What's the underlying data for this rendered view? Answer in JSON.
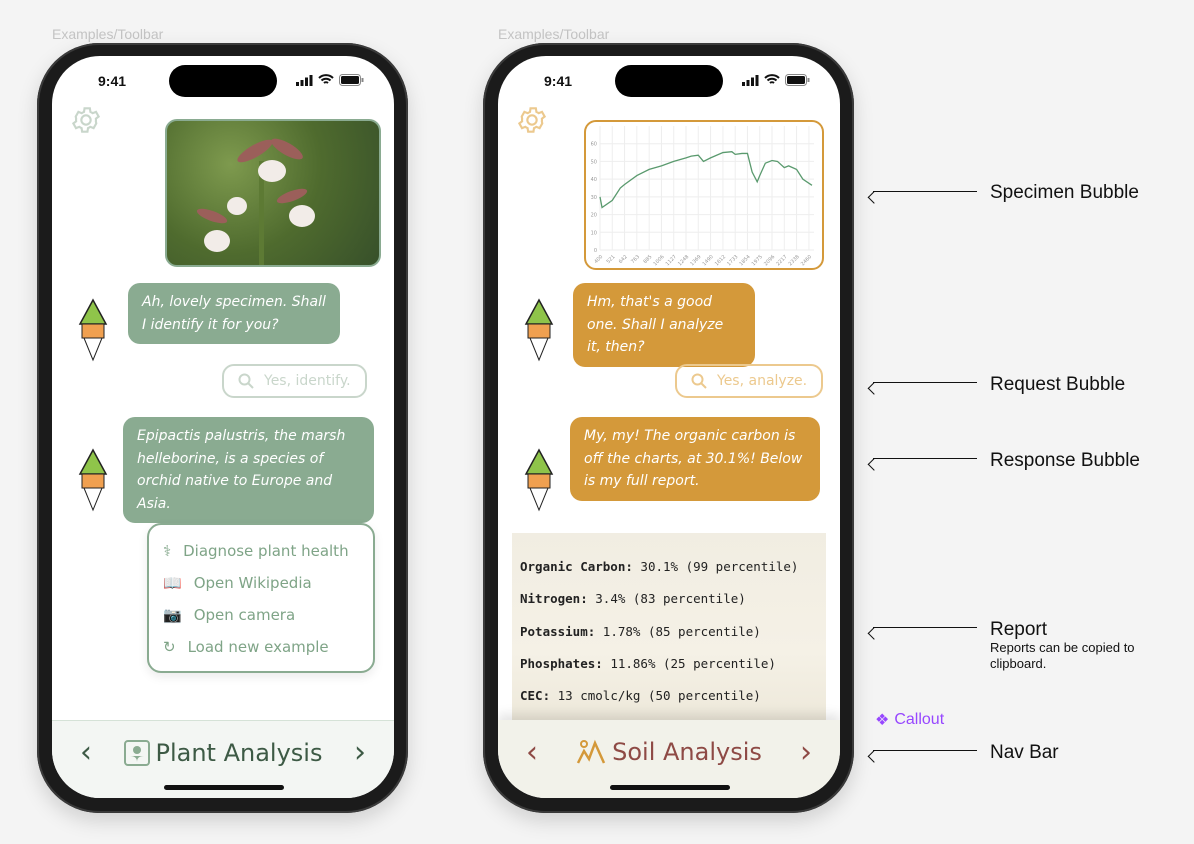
{
  "frame_labels": [
    "Examples/Toolbar",
    "Examples/Toolbar"
  ],
  "status_time": "9:41",
  "plant": {
    "accent": "#8aab91",
    "bot_message_1": "Ah, lovely specimen. Shall I identify it for you?",
    "request": "Yes, identify.",
    "bot_message_2": "Epipactis palustris, the marsh helleborine, is a species of orchid native to Europe and Asia.",
    "menu": [
      {
        "icon": "stethoscope-icon",
        "label": "Diagnose plant health"
      },
      {
        "icon": "book-icon",
        "label": "Open Wikipedia"
      },
      {
        "icon": "camera-icon",
        "label": "Open camera"
      },
      {
        "icon": "refresh-icon",
        "label": "Load new example"
      }
    ],
    "nav_title": "Plant Analysis"
  },
  "soil": {
    "accent": "#d4993a",
    "bot_message_1": "Hm, that's a good one. Shall I analyze it, then?",
    "request": "Yes, analyze.",
    "bot_message_2": "My, my! The organic carbon is off the charts, at 30.1%! Below is my full report.",
    "report": [
      {
        "key": "Organic Carbon:",
        "value": "30.1% (99 percentile)"
      },
      {
        "key": "Nitrogen:",
        "value": "3.4% (83 percentile)"
      },
      {
        "key": "Potassium:",
        "value": "1.78% (85 percentile)"
      },
      {
        "key": "Phosphates:",
        "value": "11.86% (25 percentile)"
      },
      {
        "key": "CEC:",
        "value": "13 cmolc/kg (50 percentile)"
      }
    ],
    "nav_title": "Soil Analysis"
  },
  "chart_data": {
    "type": "line",
    "ylim": [
      0,
      70
    ],
    "yticks": [
      0,
      10,
      20,
      30,
      40,
      50,
      60
    ],
    "xticks": [
      "400",
      "521",
      "642",
      "763",
      "885",
      "1006",
      "1127",
      "1248",
      "1369",
      "1490",
      "1612",
      "1733",
      "1854",
      "1975",
      "2096",
      "2217",
      "2338",
      "2460"
    ],
    "xlim": [
      400,
      2510
    ],
    "grid": true,
    "line_color": "#5a9a6e",
    "x": [
      400,
      420,
      521,
      600,
      642,
      763,
      885,
      1006,
      1127,
      1248,
      1300,
      1369,
      1420,
      1490,
      1612,
      1700,
      1733,
      1800,
      1854,
      1900,
      1950,
      1975,
      2030,
      2096,
      2150,
      2217,
      2260,
      2338,
      2400,
      2490
    ],
    "y": [
      30,
      24,
      28,
      35,
      37,
      42,
      45.5,
      47.5,
      50,
      52,
      53,
      53.5,
      50,
      52,
      55,
      55.5,
      54,
      54.5,
      54.5,
      44,
      38.5,
      42,
      49,
      50.5,
      50,
      46.5,
      47.5,
      45.5,
      40,
      36.5
    ]
  },
  "annotations": [
    {
      "title": "Specimen Bubble",
      "note": ""
    },
    {
      "title": "Request Bubble",
      "note": ""
    },
    {
      "title": "Response Bubble",
      "note": ""
    },
    {
      "title": "Report",
      "note": "Reports can be copied to clipboard."
    },
    {
      "title": "Nav Bar",
      "note": ""
    }
  ],
  "callout": {
    "icon": "component-icon",
    "label": "Callout",
    "color": "#9747ff"
  }
}
